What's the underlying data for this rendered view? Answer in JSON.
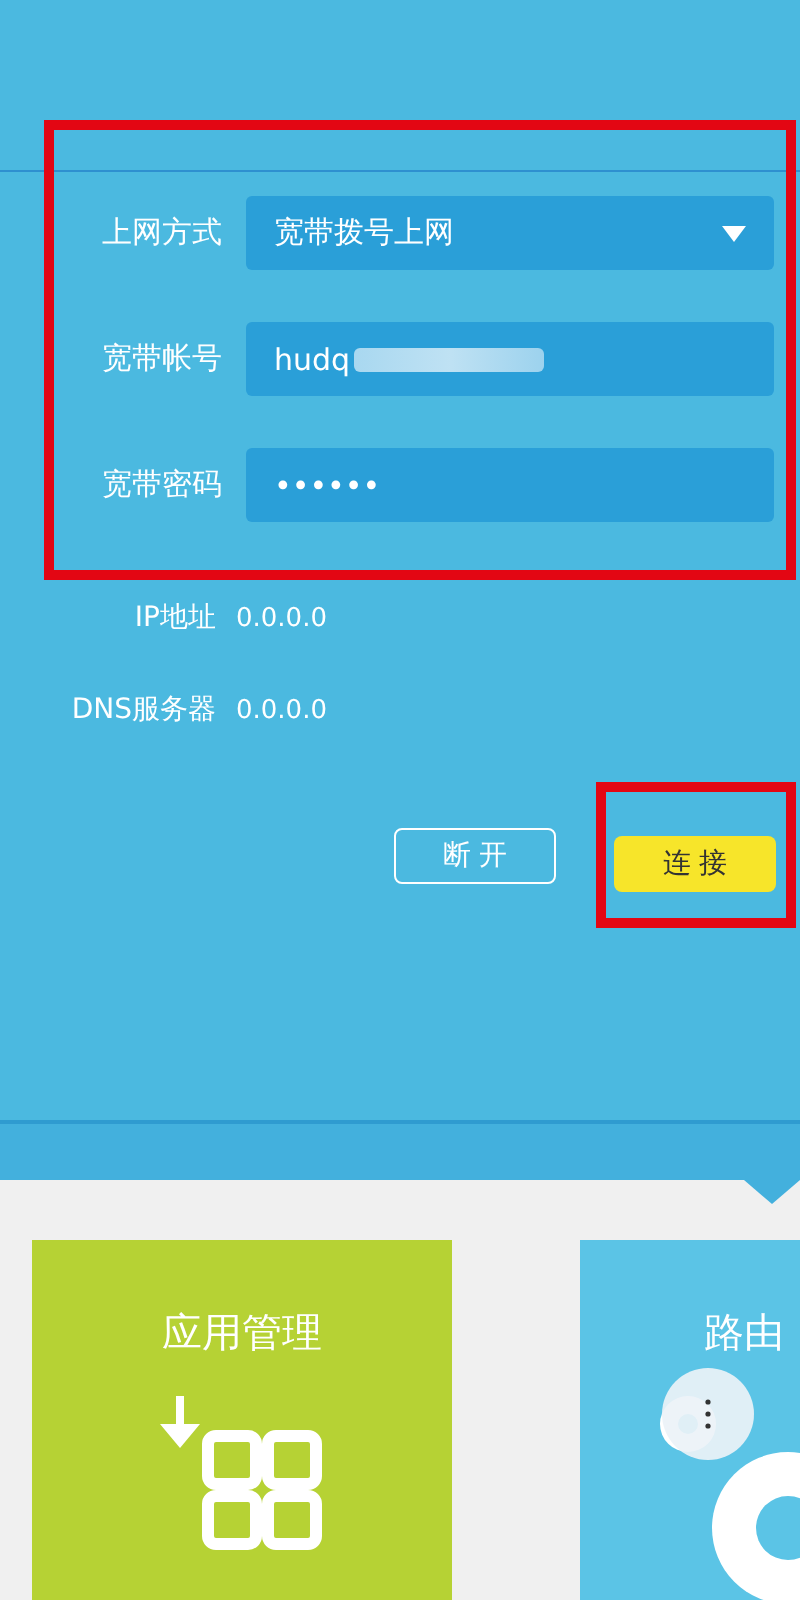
{
  "form": {
    "fields": [
      {
        "kind": "select",
        "label": "上网方式",
        "value": "宽带拨号上网"
      },
      {
        "kind": "text",
        "label": "宽带帐号",
        "value": "hudq",
        "redacted": true
      },
      {
        "kind": "password",
        "label": "宽带密码",
        "value": "••••••"
      }
    ]
  },
  "info": [
    {
      "label": "IP地址",
      "value": "0.0.0.0"
    },
    {
      "label": "DNS服务器",
      "value": "0.0.0.0"
    }
  ],
  "buttons": [
    {
      "label": "断 开",
      "kind": "outline"
    },
    {
      "label": "连 接",
      "kind": "primary"
    }
  ],
  "tiles": [
    {
      "title": "应用管理",
      "kind": "apps",
      "color": "#b6d234"
    },
    {
      "title": "路由",
      "kind": "settings",
      "color": "#5bc4e6"
    }
  ]
}
